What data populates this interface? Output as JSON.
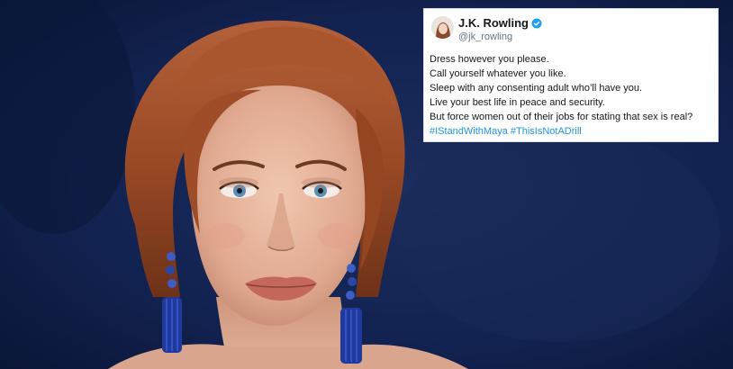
{
  "tweet": {
    "author_name": "J.K. Rowling",
    "author_handle": "@jk_rowling",
    "lines": [
      "Dress however you please.",
      "Call yourself whatever you like.",
      "Sleep with any consenting adult who’ll have you.",
      "Live your best life in peace and security.",
      "But force women out of their jobs for stating that sex is real?"
    ],
    "hashtags": [
      "#IStandWithMaya",
      "#ThisIsNotADrill"
    ],
    "verified_badge_color": "#1da1f2",
    "hashtag_color": "#1b95e0"
  },
  "photo": {
    "subject": "woman-portrait",
    "background_color": "#0d1a3a",
    "hair_color": "#a5502c",
    "earring_color": "#1f3a9c"
  }
}
